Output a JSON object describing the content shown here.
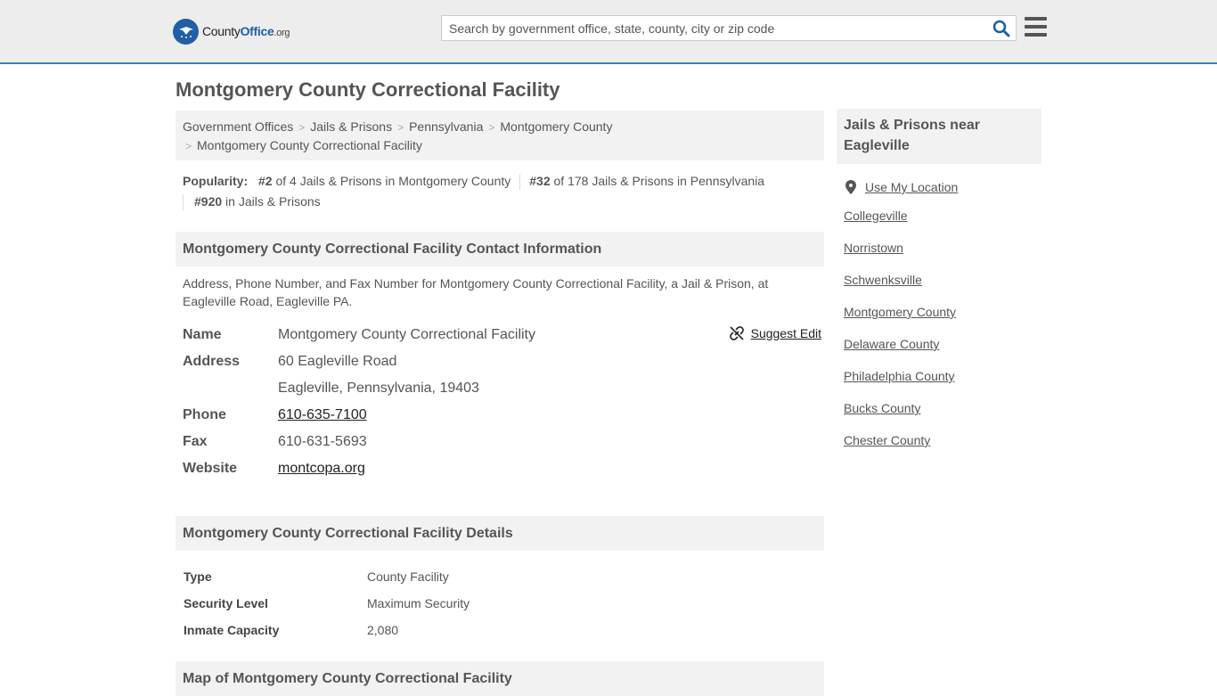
{
  "header": {
    "logo_county": "County",
    "logo_office": "Office",
    "logo_org": ".org",
    "search_placeholder": "Search by government office, state, county, city or zip code"
  },
  "page_title": "Montgomery County Correctional Facility",
  "breadcrumb": [
    "Government Offices",
    "Jails & Prisons",
    "Pennsylvania",
    "Montgomery County",
    "Montgomery County Correctional Facility"
  ],
  "popularity": {
    "label": "Popularity:",
    "r1_rank": "#2",
    "r1_text": "of 4 Jails & Prisons in Montgomery County",
    "r2_rank": "#32",
    "r2_text": "of 178 Jails & Prisons in Pennsylvania",
    "r3_rank": "#920",
    "r3_text": "in Jails & Prisons"
  },
  "contact": {
    "heading": "Montgomery County Correctional Facility Contact Information",
    "description": "Address, Phone Number, and Fax Number for Montgomery County Correctional Facility, a Jail & Prison, at Eagleville Road, Eagleville PA.",
    "suggest_edit": "Suggest Edit",
    "name_label": "Name",
    "name": "Montgomery County Correctional Facility",
    "address_label": "Address",
    "address1": "60 Eagleville Road",
    "address2": "Eagleville, Pennsylvania, 19403",
    "phone_label": "Phone",
    "phone": "610-635-7100",
    "fax_label": "Fax",
    "fax": "610-631-5693",
    "website_label": "Website",
    "website": "montcopa.org"
  },
  "details": {
    "heading": "Montgomery County Correctional Facility Details",
    "rows": [
      {
        "label": "Type",
        "value": "County Facility"
      },
      {
        "label": "Security Level",
        "value": "Maximum Security"
      },
      {
        "label": "Inmate Capacity",
        "value": "2,080"
      }
    ]
  },
  "map_heading": "Map of Montgomery County Correctional Facility",
  "sidebar": {
    "heading": "Jails & Prisons near Eagleville",
    "use_location": "Use My Location",
    "links": [
      "Collegeville",
      "Norristown",
      "Schwenksville",
      "Montgomery County",
      "Delaware County",
      "Philadelphia County",
      "Bucks County",
      "Chester County"
    ]
  }
}
